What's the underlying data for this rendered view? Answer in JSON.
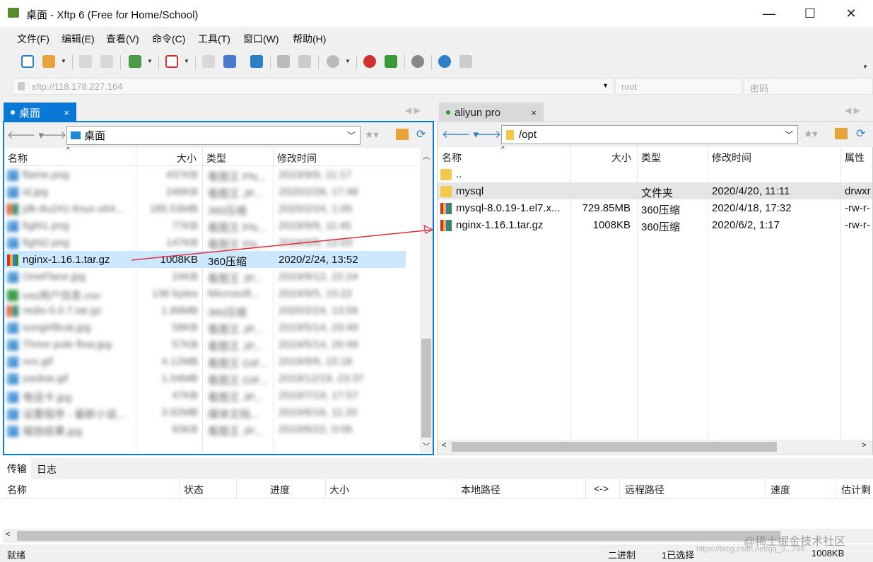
{
  "window": {
    "title": "桌面 - Xftp 6 (Free for Home/School)",
    "minimize": "—",
    "maximize": "☐",
    "close": "✕"
  },
  "menu": [
    "文件(F)",
    "编辑(E)",
    "查看(V)",
    "命令(C)",
    "工具(T)",
    "窗口(W)",
    "帮助(H)"
  ],
  "address": {
    "host": "sftp://118.178.227.164",
    "user_placeholder": "root",
    "pass_placeholder": "密码"
  },
  "left_tab": {
    "label": "桌面",
    "close": "×"
  },
  "right_tab": {
    "label": "aliyun pro",
    "close": "×"
  },
  "left_path": "桌面",
  "right_path": "/opt",
  "left_columns": [
    "名称",
    "大小",
    "类型",
    "修改时间"
  ],
  "right_columns": [
    "名称",
    "大小",
    "类型",
    "修改时间",
    "属性"
  ],
  "left_files": [
    {
      "name": "flame.png",
      "size": "437KB",
      "type": "看图王 PN...",
      "date": "2019/9/9, 11:17",
      "icon": "image",
      "blurred": true
    },
    {
      "name": "id.jpg",
      "size": "246KB",
      "type": "看图王 JP...",
      "date": "2020/2/28, 17:48",
      "icon": "image",
      "blurred": true
    },
    {
      "name": "jdk-8u241-linux-x64...",
      "size": "185.53MB",
      "type": "360压缩",
      "date": "2020/2/24, 1:05",
      "icon": "zip",
      "blurred": true
    },
    {
      "name": "fight1.png",
      "size": "77KB",
      "type": "看图王 PN...",
      "date": "2019/9/9, 11:45",
      "icon": "image",
      "blurred": true
    },
    {
      "name": "fight2.png",
      "size": "147KB",
      "type": "看图王 PN...",
      "date": "2019/9/9, 12:03",
      "icon": "image",
      "blurred": true
    },
    {
      "name": "nginx-1.16.1.tar.gz",
      "size": "1008KB",
      "type": "360压缩",
      "date": "2020/2/24, 13:52",
      "icon": "zip",
      "blurred": false,
      "selected": true
    },
    {
      "name": "OneFlace.jpg",
      "size": "24KB",
      "type": "看图王 JP...",
      "date": "2019/9/12, 22:24",
      "icon": "image",
      "blurred": true
    },
    {
      "name": "oss用户信息.csv",
      "size": "136 bytes",
      "type": "Microsoft...",
      "date": "2019/9/5, 15:22",
      "icon": "csv",
      "blurred": true
    },
    {
      "name": "redis-5.0.7.tar.gz",
      "size": "1.89MB",
      "type": "360压缩",
      "date": "2020/2/24, 13:56",
      "icon": "zip",
      "blurred": true
    },
    {
      "name": "sungirl8cat.jpg",
      "size": "58KB",
      "type": "看图王 JP...",
      "date": "2019/5/14, 23:49",
      "icon": "image",
      "blurred": true
    },
    {
      "name": "Three pole flow.jpg",
      "size": "57KB",
      "type": "看图王 JP...",
      "date": "2019/5/14, 20:49",
      "icon": "image",
      "blurred": true
    },
    {
      "name": "xxx.gif",
      "size": "4.12MB",
      "type": "看图王 GIF...",
      "date": "2019/9/9, 15:18",
      "icon": "image",
      "blurred": true
    },
    {
      "name": "yaobai.gif",
      "size": "1.04MB",
      "type": "看图王 GIF...",
      "date": "2019/12/19, 23:37",
      "icon": "image",
      "blurred": true
    },
    {
      "name": "电话卡.jpg",
      "size": "47KB",
      "type": "看图王 JP...",
      "date": "2019/7/19, 17:57",
      "icon": "image",
      "blurred": true
    },
    {
      "name": "设置程序 - 最新小说...",
      "size": "3.92MB",
      "type": "媒体文档...",
      "date": "2019/6/16, 11:20",
      "icon": "image",
      "blurred": true
    },
    {
      "name": "缩放结果.jpg",
      "size": "93KB",
      "type": "看图王 JP...",
      "date": "2019/6/22, 0:06",
      "icon": "image",
      "blurred": true
    }
  ],
  "right_files": [
    {
      "name": "..",
      "size": "",
      "type": "",
      "date": "",
      "attr": "",
      "icon": "folder"
    },
    {
      "name": "mysql",
      "size": "",
      "type": "文件夹",
      "date": "2020/4/20, 11:11",
      "attr": "drwxr",
      "icon": "folder",
      "selected": true
    },
    {
      "name": "mysql-8.0.19-1.el7.x...",
      "size": "729.85MB",
      "type": "360压缩",
      "date": "2020/4/18, 17:32",
      "attr": "-rw-r-",
      "icon": "zip"
    },
    {
      "name": "nginx-1.16.1.tar.gz",
      "size": "1008KB",
      "type": "360压缩",
      "date": "2020/6/2, 1:17",
      "attr": "-rw-r-",
      "icon": "zip"
    }
  ],
  "bottom_tabs": [
    "传输",
    "日志"
  ],
  "transfer_columns": [
    "名称",
    "状态",
    "进度",
    "大小",
    "本地路径",
    "<->",
    "远程路径",
    "速度",
    "估计剩"
  ],
  "status": {
    "left": "就绪",
    "mode": "二进制",
    "selection": "1已选择",
    "size": "1008KB"
  },
  "watermark": "@稀土掘金技术社区",
  "watermark2": "https://blog.csdn.net/qq_3...788",
  "colors": {
    "accent": "#0a78d7",
    "selection": "#cce8ff",
    "arrow": "#e0303a"
  }
}
